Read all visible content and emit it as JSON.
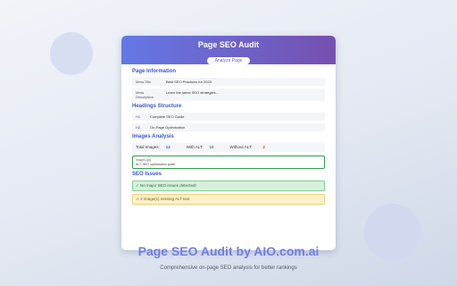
{
  "popup": {
    "title": "Page SEO Audit",
    "analyze_label": "Analyze Page"
  },
  "page_info": {
    "heading": "Page Information",
    "meta_title_label": "Meta Title",
    "meta_title_value": "Best SEO Practices for 2025",
    "meta_description_label": "Meta Description",
    "meta_description_value": "Learn the latest SEO strategies..."
  },
  "headings": {
    "heading": "Headings Structure",
    "items": [
      {
        "tag": "H1",
        "text": "Complete SEO Guide"
      },
      {
        "tag": "H2",
        "text": "On-Page Optimization"
      }
    ]
  },
  "images": {
    "heading": "Images Analysis",
    "total_label": "Total Images:",
    "total_value": "12",
    "with_alt_label": "With ALT:",
    "with_alt_value": "10",
    "without_alt_label": "Without ALT:",
    "without_alt_value": "2",
    "item_src": "image1.jpg",
    "item_alt": "ALT: SEO optimization guide"
  },
  "issues": {
    "heading": "SEO Issues",
    "ok_message": "✓ No major SEO issues detected!",
    "warn_message": "⚠ 2 image(s) missing ALT text"
  },
  "footer": {
    "title": "Page SEO Audit by AIO.com.ai",
    "subtitle": "Comprehensive on-page SEO analysis for better rankings"
  },
  "colors": {
    "header_start": "#6478e6",
    "header_end": "#7650b0",
    "accent": "#3b57c8",
    "success": "#2a9a3c",
    "danger": "#d23b3b"
  }
}
